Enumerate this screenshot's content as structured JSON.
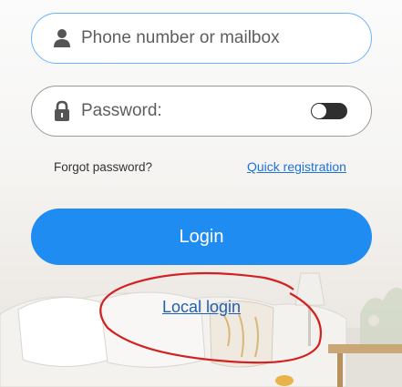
{
  "form": {
    "phone_placeholder": "Phone number or mailbox",
    "password_placeholder": "Password:",
    "forgot_label": "Forgot password?",
    "quick_registration_label": "Quick registration",
    "login_label": "Login",
    "local_login_label": "Local login"
  },
  "colors": {
    "primary_button": "#1e8cf0",
    "link": "#1e73d8",
    "annotation": "#d32020"
  },
  "icons": {
    "user": "person-icon",
    "lock": "lock-icon"
  },
  "toggle": {
    "on": false
  }
}
